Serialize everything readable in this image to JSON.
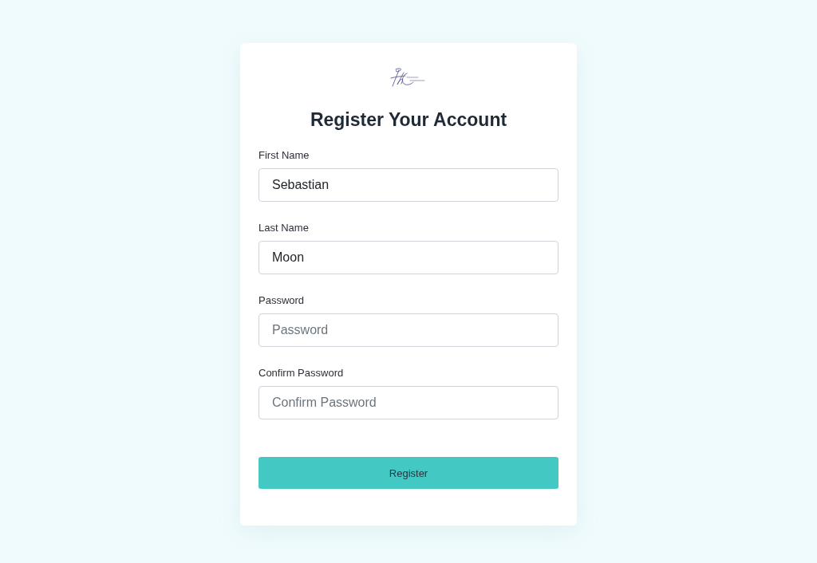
{
  "title": "Register Your Account",
  "fields": [
    {
      "label": "First Name",
      "value": "Sebastian"
    },
    {
      "label": "Last Name",
      "value": "Moon"
    },
    {
      "label": "Password",
      "placeholder": "Password"
    },
    {
      "label": "Confirm Password",
      "placeholder": "Confirm Password"
    }
  ],
  "submit_button": {
    "label": "Register"
  }
}
